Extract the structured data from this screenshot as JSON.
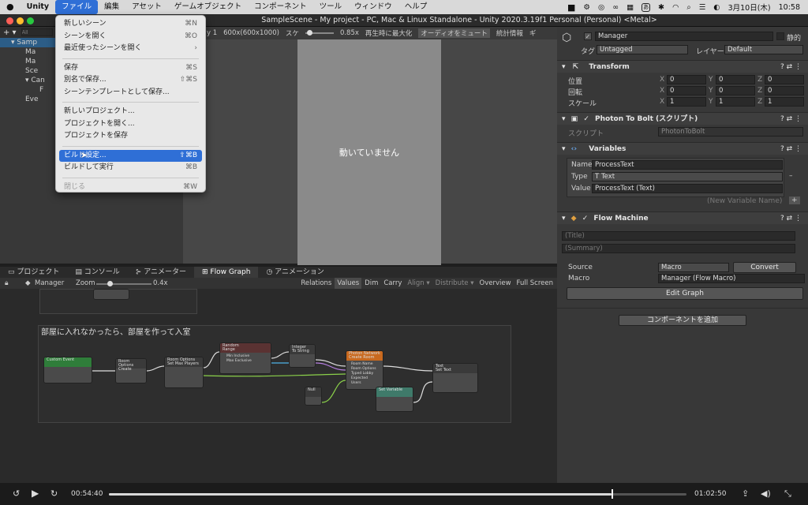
{
  "menubar": {
    "app": "Unity",
    "items": [
      "ファイル",
      "編集",
      "アセット",
      "ゲームオブジェクト",
      "コンポーネント",
      "ツール",
      "ウィンドウ",
      "ヘルプ"
    ],
    "date": "3月10日(木)",
    "time": "10:58",
    "ime": "あ"
  },
  "window_title": "SampleScene - My project - PC, Mac & Linux Standalone - Unity 2020.3.19f1 Personal (Personal) <Metal>",
  "file_menu": {
    "items": [
      {
        "label": "新しいシーン",
        "shortcut": "⌘N"
      },
      {
        "label": "シーンを開く",
        "shortcut": "⌘O"
      },
      {
        "label": "最近使ったシーンを開く",
        "shortcut": "›"
      },
      {
        "sep": true
      },
      {
        "label": "保存",
        "shortcut": "⌘S"
      },
      {
        "label": "別名で保存...",
        "shortcut": "⇧⌘S"
      },
      {
        "label": "シーンテンプレートとして保存...",
        "shortcut": ""
      },
      {
        "sep": true
      },
      {
        "label": "新しいプロジェクト...",
        "shortcut": ""
      },
      {
        "label": "プロジェクトを開く...",
        "shortcut": ""
      },
      {
        "label": "プロジェクトを保存",
        "shortcut": ""
      },
      {
        "sep": true
      },
      {
        "label": "ビルド設定...",
        "shortcut": "⇧⌘B",
        "selected": true
      },
      {
        "label": "ビルドして実行",
        "shortcut": "⌘B"
      },
      {
        "sep": true
      },
      {
        "label": "閉じる",
        "shortcut": "⌘W",
        "disabled": true
      }
    ]
  },
  "hierarchy": {
    "add": "+ ▾",
    "search_placeholder": "All",
    "rows": [
      {
        "indent": 0,
        "text": "▾ Samp",
        "sel": true
      },
      {
        "indent": 1,
        "text": "Ma"
      },
      {
        "indent": 1,
        "text": "Ma"
      },
      {
        "indent": 1,
        "text": "Sce"
      },
      {
        "indent": 1,
        "text": "▾ Can"
      },
      {
        "indent": 2,
        "text": "F"
      },
      {
        "indent": 1,
        "text": "Eve"
      }
    ]
  },
  "scene_toolbar": {
    "display": "y 1",
    "resolution": "600x(600x1000)",
    "scale_label": "スケ",
    "scale_value": "0.85x",
    "maximize": "再生時に最大化",
    "mute": "オーディオをミュート",
    "stats": "統計情報",
    "gizmos": "ギ"
  },
  "game_view_text": "動いていません",
  "bottom_tabs": [
    "プロジェクト",
    "コンソール",
    "アニメーター",
    "Flow Graph",
    "アニメーション"
  ],
  "graph_toolbar": {
    "object": "Manager",
    "zoom_label": "Zoom",
    "zoom_value": "0.4x",
    "buttons": [
      "Relations",
      "Values",
      "Dim",
      "Carry",
      "Align ▾",
      "Distribute ▾",
      "Overview",
      "Full Screen"
    ]
  },
  "graph": {
    "group_title": "部屋に入れなかったら、部屋を作って入室",
    "nodes": [
      {
        "title": "Custom Event",
        "sub": "",
        "color": "#2f7d3a"
      },
      {
        "title": "Room Options",
        "sub": "Create"
      },
      {
        "title": "Room Options",
        "sub": "Set Max Players"
      },
      {
        "title": "Random",
        "sub": "Range",
        "color": "#b03030"
      },
      {
        "title": "Integer",
        "sub": "To String"
      },
      {
        "title": "Photon Network",
        "sub": "Create Room",
        "color": "#c9691e"
      },
      {
        "title": "Text",
        "sub": "Set Text"
      },
      {
        "title": "Null",
        "sub": ""
      },
      {
        "title": "Set Variable",
        "sub": "",
        "color": "#3f7a6a"
      }
    ],
    "port_labels": [
      "Min Inclusive",
      "Max Exclusive",
      "Room Name",
      "Room Options",
      "Typed Lobby",
      "Expected Users"
    ]
  },
  "inspector": {
    "name": "Manager",
    "static": "静的",
    "tag_label": "タグ",
    "tag": "Untagged",
    "layer_label": "レイヤー",
    "layer": "Default",
    "transform": {
      "title": "Transform",
      "rows": [
        {
          "label": "位置",
          "x": "0",
          "y": "0",
          "z": "0"
        },
        {
          "label": "回転",
          "x": "0",
          "y": "0",
          "z": "0"
        },
        {
          "label": "スケール",
          "x": "1",
          "y": "1",
          "z": "1"
        }
      ]
    },
    "photon": {
      "title": "Photon To Bolt (スクリプト)",
      "script_label": "スクリプト",
      "script": "PhotonToBolt"
    },
    "variables": {
      "title": "Variables",
      "name_label": "Name",
      "name": "ProcessText",
      "type_label": "Type",
      "type": "Text",
      "value_label": "Value",
      "value": "ProcessText (Text)",
      "new_placeholder": "(New Variable Name)"
    },
    "flow": {
      "title": "Flow Machine",
      "title_placeholder": "(Title)",
      "summary_placeholder": "(Summary)",
      "source_label": "Source",
      "source": "Macro",
      "convert": "Convert",
      "macro_label": "Macro",
      "macro": "Manager (Flow Macro)",
      "edit": "Edit Graph"
    },
    "add_component": "コンポーネントを追加"
  },
  "player": {
    "current": "00:54:40",
    "total": "01:02:50",
    "progress": 0.87
  }
}
